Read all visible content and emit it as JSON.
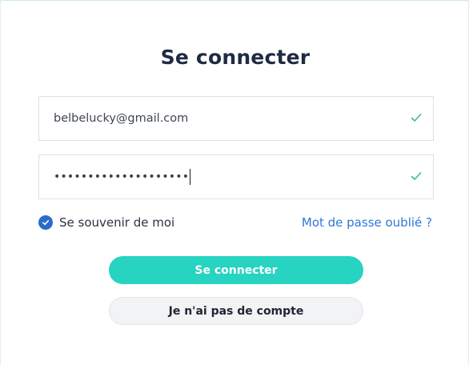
{
  "form": {
    "title": "Se connecter",
    "email": {
      "value": "belbelucky@gmail.com",
      "valid": true
    },
    "password": {
      "masked_value": "••••••••••••••••••••",
      "valid": true
    },
    "remember_me": {
      "label": "Se souvenir de moi",
      "checked": true
    },
    "forgot_password_link": "Mot de passe oublié ?",
    "submit_button": "Se connecter",
    "no_account_button": "Je n'ai pas de compte"
  },
  "colors": {
    "accent": "#27d3c1",
    "link": "#2f78d6",
    "checkbox": "#2a6cc9",
    "valid_check": "#3fbf77",
    "title": "#1f2a44"
  },
  "icons": {
    "field_valid": "checkmark-icon",
    "checkbox": "checkbox-checked-icon"
  }
}
